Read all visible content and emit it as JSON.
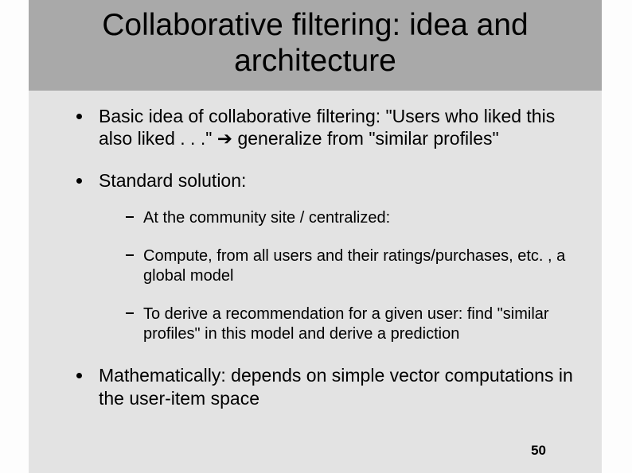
{
  "title": "Collaborative filtering: idea and architecture",
  "bullets": {
    "b1": "Basic idea of collaborative filtering: \"Users who liked this also liked . . .\" ➔ generalize from \"similar profiles\"",
    "b2": "Standard solution:",
    "b2_sub": {
      "s1": "At the community site / centralized:",
      "s2": "Compute, from all users and their ratings/purchases, etc. , a global model",
      "s3": "To derive a recommendation for a given user: find \"similar profiles\" in this model and derive a prediction"
    },
    "b3": "Mathematically: depends on simple vector computations in the user-item space"
  },
  "page_number": "50"
}
